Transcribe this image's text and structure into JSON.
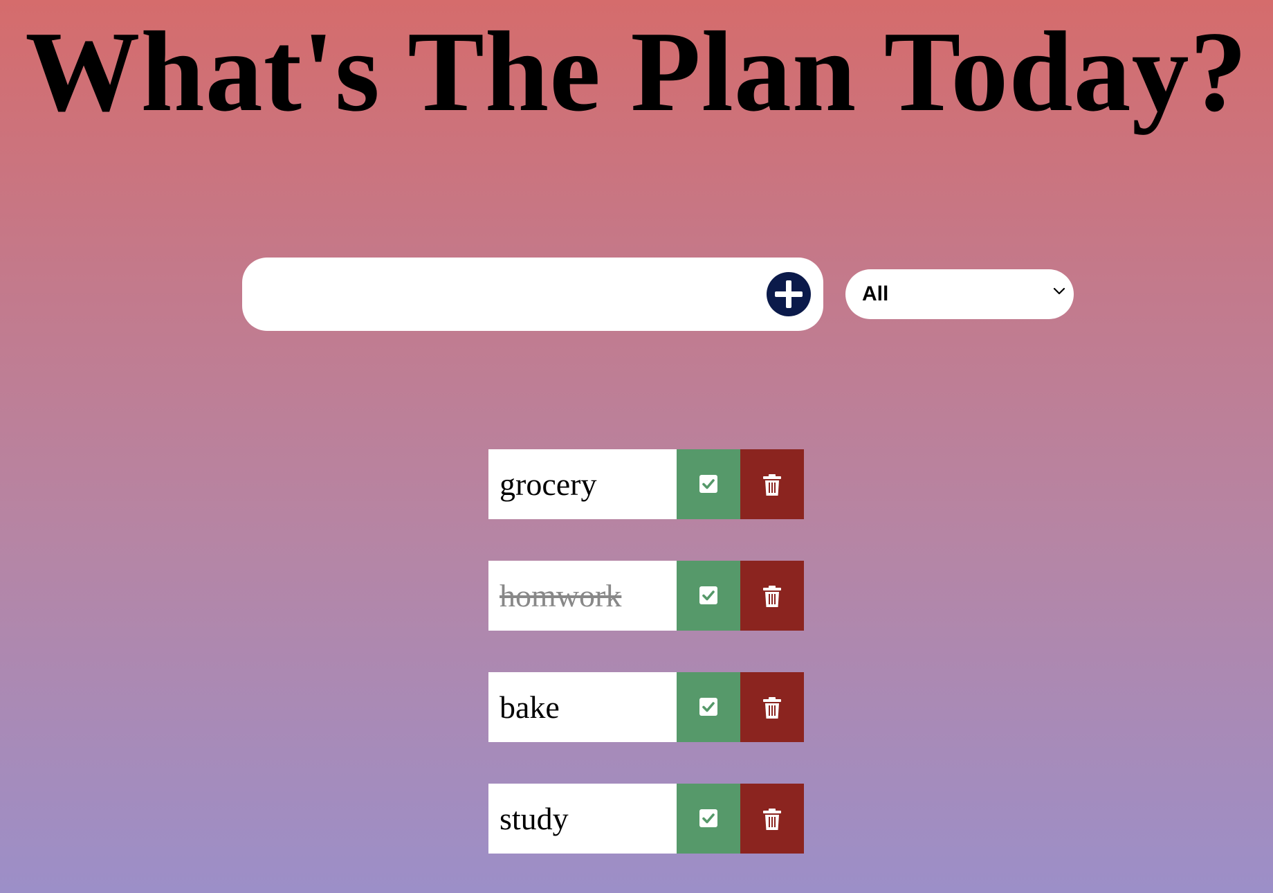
{
  "header": {
    "title": "What's The Plan Today?"
  },
  "form": {
    "input_value": "",
    "add_icon": "plus-circle-icon",
    "filter_selected": "All",
    "filter_icon": "chevron-down-icon"
  },
  "todos": [
    {
      "text": "grocery",
      "completed": false
    },
    {
      "text": "homwork",
      "completed": true
    },
    {
      "text": "bake",
      "completed": false
    },
    {
      "text": "study",
      "completed": false
    }
  ],
  "actions": {
    "complete_icon": "check-square-icon",
    "delete_icon": "trash-icon"
  },
  "colors": {
    "gradient_top": "#d56c6c",
    "gradient_bottom": "#9c8fc8",
    "add_button": "#0b1a4a",
    "complete_button": "#56996a",
    "trash_button": "#8b241f",
    "completed_text": "#888888"
  }
}
